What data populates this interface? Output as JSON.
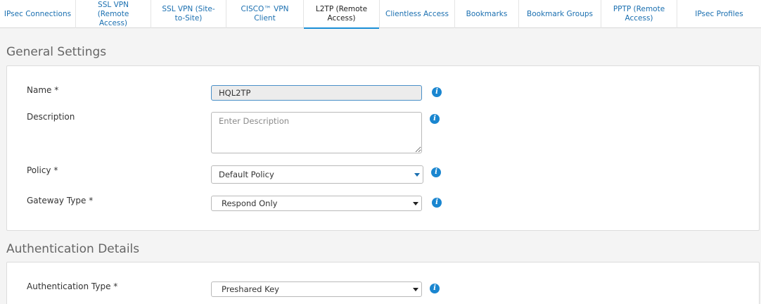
{
  "tabs": [
    {
      "label": "IPsec Connections"
    },
    {
      "label": "SSL VPN (Remote Access)"
    },
    {
      "label": "SSL VPN (Site-to-Site)"
    },
    {
      "label": "CISCO™ VPN Client"
    },
    {
      "label": "L2TP (Remote Access)"
    },
    {
      "label": "Clientless Access"
    },
    {
      "label": "Bookmarks"
    },
    {
      "label": "Bookmark Groups"
    },
    {
      "label": "PPTP (Remote Access)"
    },
    {
      "label": "IPsec Profiles"
    }
  ],
  "general": {
    "title": "General Settings",
    "name_label": "Name *",
    "name_value": "HQL2TP",
    "description_label": "Description",
    "description_placeholder": "Enter Description",
    "policy_label": "Policy *",
    "policy_value": "Default Policy",
    "gateway_label": "Gateway Type *",
    "gateway_value": "Respond Only"
  },
  "auth": {
    "title": "Authentication Details",
    "type_label": "Authentication Type *",
    "type_value": "Preshared Key"
  },
  "icons": {
    "info": "i"
  },
  "colors": {
    "accent": "#1a86d0",
    "link": "#1a6fb0"
  }
}
